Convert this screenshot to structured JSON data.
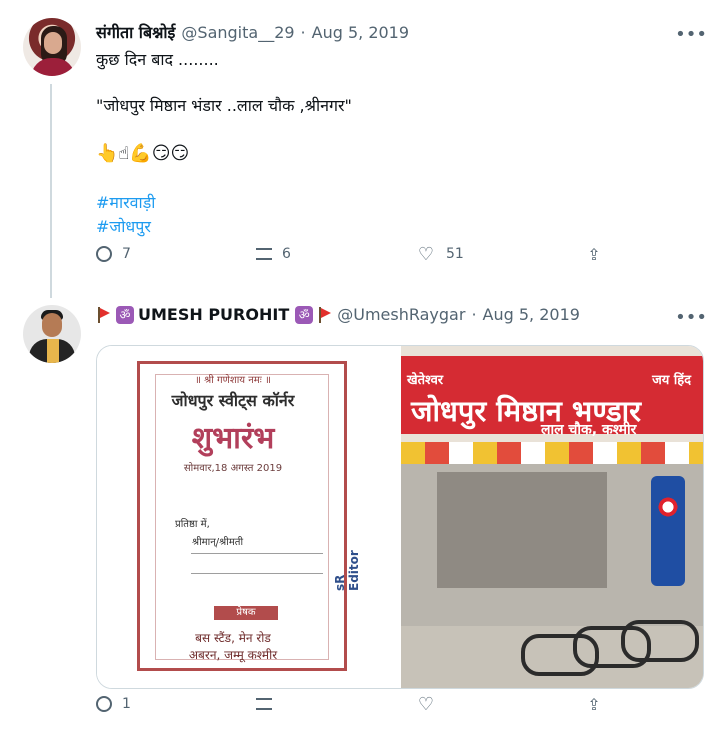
{
  "tweets": [
    {
      "author": {
        "name": "संगीता बिश्नोई",
        "handle": "@Sangita__29"
      },
      "date": "Aug 5, 2019",
      "lines": [
        "कुछ दिन बाद ........",
        "\"जोधपुर मिष्ठान भंडार ..लाल चौक ,श्रीनगर\""
      ],
      "emojis": "👆☝💪😏😏",
      "hashtags": [
        "#मारवाड़ी",
        "#जोधपुर"
      ],
      "actions": {
        "reply": "7",
        "retweet": "6",
        "like": "51"
      }
    },
    {
      "author": {
        "name": "UMESH PUROHIT",
        "handle": "@UmeshRaygar"
      },
      "date": "Aug 5, 2019",
      "actions": {
        "reply": "1",
        "retweet": "",
        "like": ""
      },
      "media": {
        "left": {
          "top": "॥ श्री गणेशाय नमः ॥",
          "title": "जोधपुर स्वीट्स कॉर्नर",
          "sub": "शुभारंभ",
          "date": "सोमवार,18 अगस्त 2019",
          "label1": "प्रतिष्ठा में,",
          "label2": "श्रीमान्/श्रीमती",
          "prashak": "प्रेषक",
          "addr1": "बस स्टैंड, मेन रोड",
          "addr2": "अबरन, जम्मू कश्मीर",
          "editor": "sR Editor"
        },
        "right": {
          "signLeft": "खेतेश्वर",
          "signRight": "जय हिंद",
          "main": "जोधपुर मिष्ठान भण्डार",
          "sub": "लाल चौक, कश्मीर"
        }
      }
    }
  ]
}
